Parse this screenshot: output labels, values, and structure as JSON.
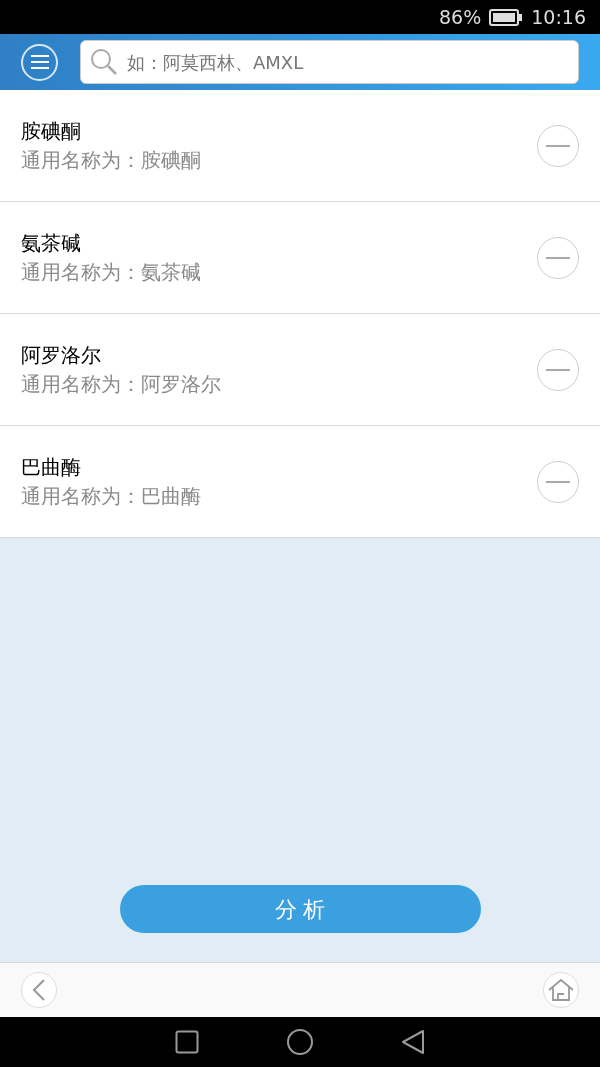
{
  "status_bar": {
    "battery_text": "86%",
    "time": "10:16"
  },
  "search": {
    "placeholder": "如：阿莫西林、AMXL"
  },
  "drugs": [
    {
      "name": "胺碘酮",
      "generic": "通用名称为：胺碘酮"
    },
    {
      "name": "氨茶碱",
      "generic": "通用名称为：氨茶碱"
    },
    {
      "name": "阿罗洛尔",
      "generic": "通用名称为：阿罗洛尔"
    },
    {
      "name": "巴曲酶",
      "generic": "通用名称为：巴曲酶"
    }
  ],
  "analyze_button": "分 析"
}
